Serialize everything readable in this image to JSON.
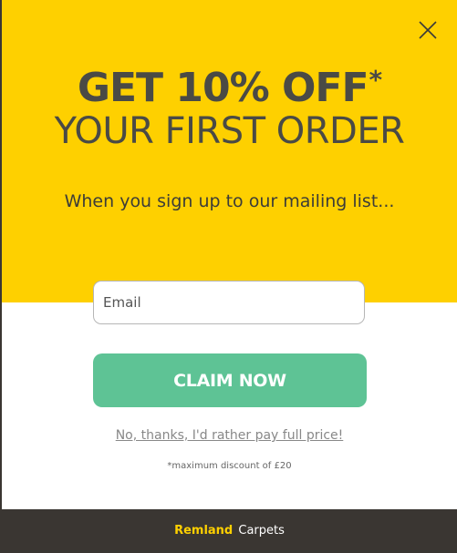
{
  "popup": {
    "close_icon": "close-icon",
    "headline": "GET 10% OFF",
    "headline_asterisk": "*",
    "subhead": "YOUR FIRST ORDER",
    "tagline": "When you sign up to our mailing list...",
    "email_placeholder": "Email",
    "email_value": "",
    "claim_label": "CLAIM NOW",
    "decline_label": "No, thanks, I'd rather pay full price!",
    "disclaimer": "*maximum discount of £20"
  },
  "footer": {
    "brand_primary": "Remland",
    "brand_secondary": "Carpets"
  },
  "colors": {
    "hero_background": "#fed000",
    "claim_button": "#5ec395",
    "headline_text": "#4a4a45",
    "footer_background": "#3a3632"
  }
}
